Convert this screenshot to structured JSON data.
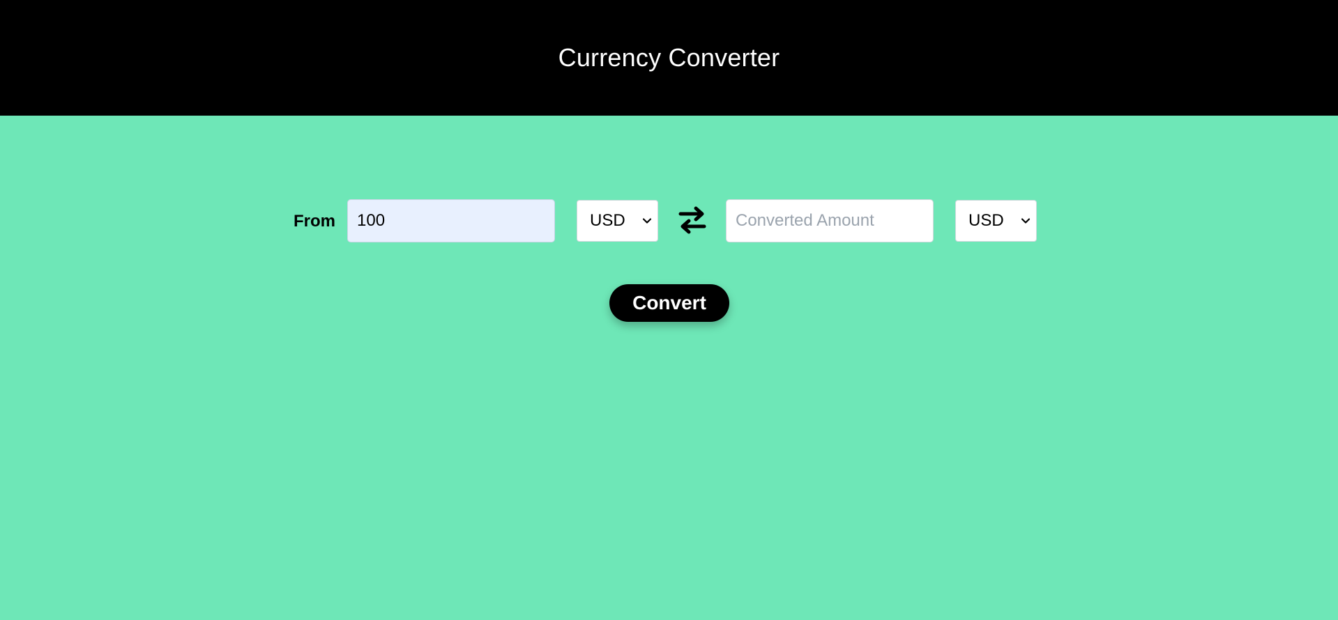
{
  "header": {
    "title": "Currency Converter",
    "background": "#000000"
  },
  "converter": {
    "from_label": "From",
    "amount_value": "100",
    "from_currency": "USD",
    "swap_icon": "swap-arrows-icon",
    "converted_placeholder": "Converted Amount",
    "converted_value": "",
    "to_currency": "USD",
    "convert_label": "Convert"
  },
  "colors": {
    "page_background": "#6ee7b7",
    "input_autofill_background": "#e8f0fe",
    "button_background": "#000000"
  }
}
